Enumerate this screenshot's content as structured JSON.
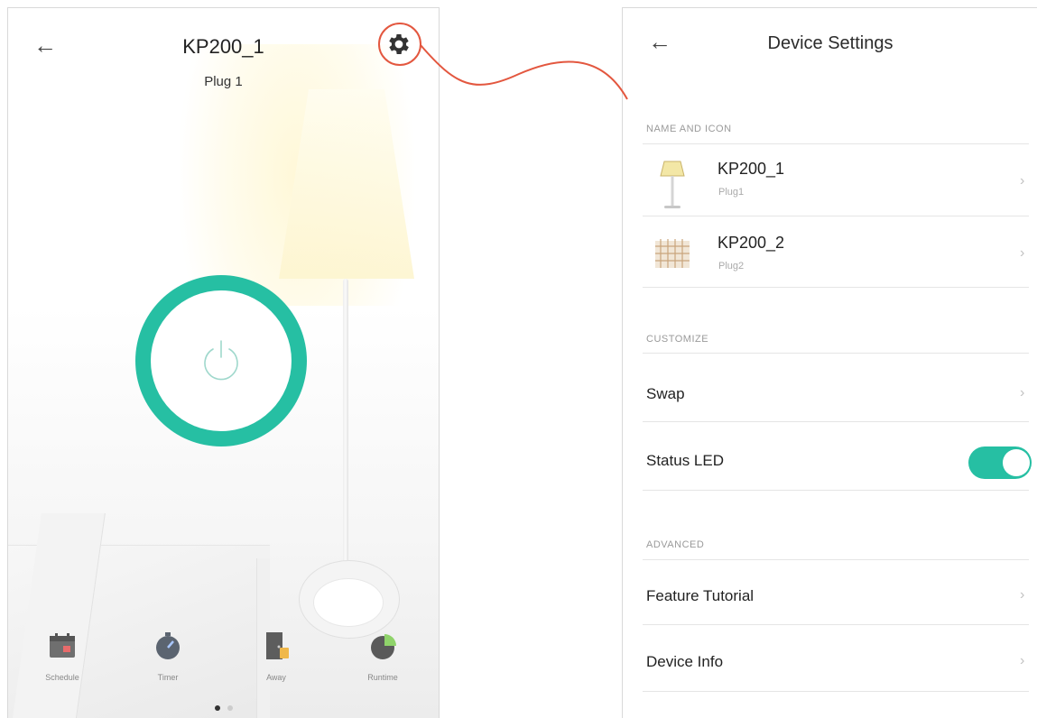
{
  "left": {
    "title": "KP200_1",
    "subtitle": "Plug 1",
    "back_icon": "back-arrow-icon",
    "settings_icon": "gear-icon",
    "power_state": "on",
    "toolbar": [
      {
        "label": "Schedule",
        "icon": "calendar-icon"
      },
      {
        "label": "Timer",
        "icon": "stopwatch-icon"
      },
      {
        "label": "Away",
        "icon": "away-door-icon"
      },
      {
        "label": "Runtime",
        "icon": "runtime-chart-icon"
      }
    ],
    "page_dots": {
      "count": 2,
      "active": 1
    }
  },
  "right": {
    "title": "Device Settings",
    "back_icon": "back-arrow-icon",
    "sections": {
      "name_and_icon": "NAME AND ICON",
      "customize": "CUSTOMIZE",
      "advanced": "ADVANCED"
    },
    "devices": [
      {
        "name": "KP200_1",
        "sub": "Plug1",
        "icon": "floor-lamp-icon"
      },
      {
        "name": "KP200_2",
        "sub": "Plug2",
        "icon": "string-lights-icon"
      }
    ],
    "customize_rows": {
      "swap": "Swap",
      "status_led": "Status LED"
    },
    "status_led_on": true,
    "advanced_rows": {
      "feature_tutorial": "Feature Tutorial",
      "device_info": "Device Info"
    },
    "chevron": "›"
  },
  "colors": {
    "accent": "#26bfa3",
    "callout": "#e3573f"
  }
}
